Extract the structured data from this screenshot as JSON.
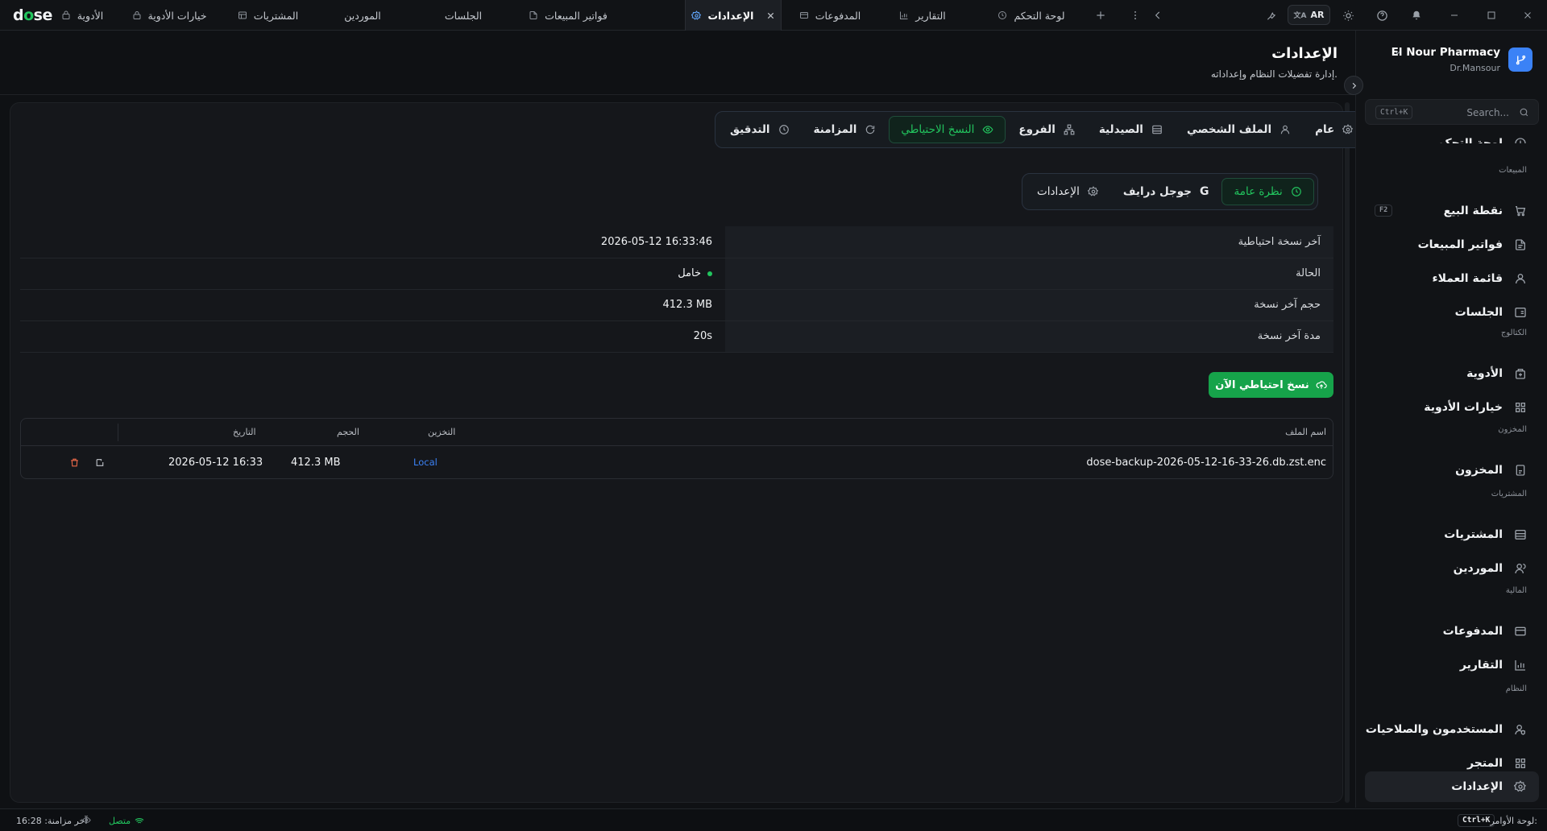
{
  "app": {
    "logo_pre": "d",
    "logo_o": "o",
    "logo_post": "se"
  },
  "tabs": [
    {
      "label": "الأدوية",
      "icon": "pill-icon"
    },
    {
      "label": "خيارات الأدوية",
      "icon": "lock-icon"
    },
    {
      "label": "المشتريات",
      "icon": "store-icon"
    },
    {
      "label": "الموردين",
      "icon": ""
    },
    {
      "label": "الجلسات",
      "icon": ""
    },
    {
      "label": "فواتير المبيعات",
      "icon": "file-icon"
    },
    {
      "label": "الإعدادات",
      "icon": "gear-icon",
      "active": true
    },
    {
      "label": "المدفوعات",
      "icon": "card-icon"
    },
    {
      "label": "التقارير",
      "icon": "chart-icon"
    },
    {
      "label": "لوحة التحكم",
      "icon": "clock-icon"
    }
  ],
  "toolbar": {
    "lang": "AR"
  },
  "header": {
    "title": "الإعدادات",
    "subtitle": "إدارة تفضيلات النظام وإعداداته."
  },
  "settings_tabs": [
    {
      "label": "عام",
      "icon": "gear-icon"
    },
    {
      "label": "الملف الشخصي",
      "icon": "user-icon"
    },
    {
      "label": "الصيدلية",
      "icon": "store-icon"
    },
    {
      "label": "الفروع",
      "icon": "branches-icon"
    },
    {
      "label": "النسخ الاحتياطي",
      "icon": "eye-icon",
      "active": true
    },
    {
      "label": "المزامنة",
      "icon": "refresh-icon"
    },
    {
      "label": "التدقيق",
      "icon": "history-icon"
    }
  ],
  "backup_tabs": [
    {
      "label": "نظرة عامة",
      "icon": "history-icon",
      "active": true
    },
    {
      "label": "جوجل درايف",
      "icon": "google-icon"
    },
    {
      "label": "الإعدادات",
      "icon": "gear-icon"
    }
  ],
  "info": {
    "last_backup_label": "آخر نسخة احتياطية",
    "last_backup_value": "2026-05-12 16:33:46",
    "status_label": "الحالة",
    "status_value": "خامل",
    "size_label": "حجم آخر نسخة",
    "size_value": "412.3 MB",
    "duration_label": "مدة آخر نسخة",
    "duration_value": "20s"
  },
  "backup_now_label": "نسخ احتياطي الآن",
  "files": {
    "headers": {
      "filename": "اسم الملف",
      "storage": "التخزين",
      "size": "الحجم",
      "date": "التاريخ"
    },
    "rows": [
      {
        "filename": "dose-backup-2026-05-12-16-33-26.db.zst.enc",
        "storage": "Local",
        "size": "412.3 MB",
        "date": "2026-05-12 16:33"
      }
    ]
  },
  "sidebar": {
    "pharmacy": "El Nour Pharmacy",
    "user": "Dr.Mansour",
    "search_placeholder": "Search...",
    "search_kbd": "Ctrl+K",
    "partial_item": "لوحة التحكم",
    "groups": {
      "sales": "المبيعات",
      "catalog": "الكتالوج",
      "inventory": "المخزون",
      "purchases": "المشتريات",
      "finance": "المالية",
      "system": "النظام"
    },
    "items": {
      "pos": "نقطة البيع",
      "pos_kbd": "F2",
      "invoices": "فواتير المبيعات",
      "customers": "قائمة العملاء",
      "sessions": "الجلسات",
      "medicines": "الأدوية",
      "med_options": "خيارات الأدوية",
      "inventory": "المخزون",
      "purchases": "المشتريات",
      "suppliers": "الموردين",
      "payments": "المدفوعات",
      "reports": "التقارير",
      "users": "المستخدمون والصلاحيات",
      "store": "المتجر",
      "settings": "الإعدادات"
    }
  },
  "status": {
    "last_sync": "آخر مزامنة: 16:28",
    "connected": "متصل",
    "cmd_label": "لوحة الأوامر:",
    "cmd_kbd": "Ctrl+K"
  },
  "colors": {
    "accent": "#22c55e",
    "brand": "#3b82f6",
    "bg": "#0f1114"
  }
}
